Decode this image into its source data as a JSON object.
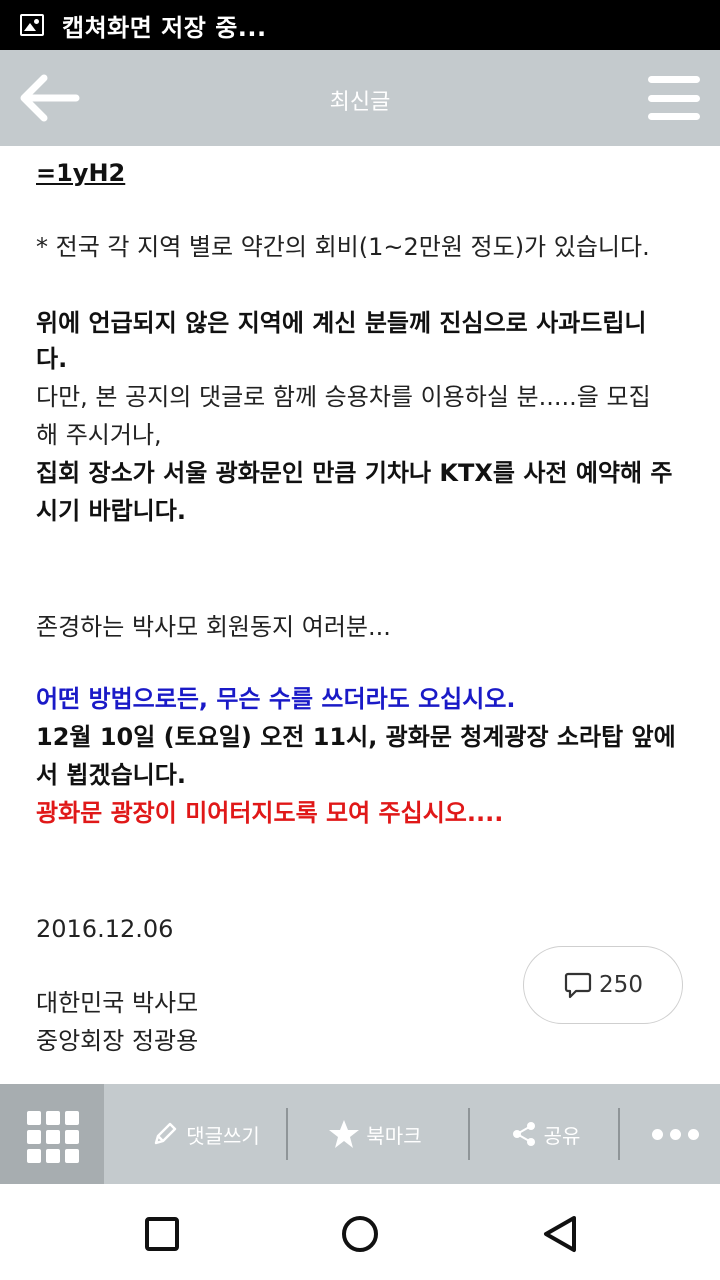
{
  "status_bar": {
    "text": "캡쳐화면 저장 중..."
  },
  "header": {
    "title": "최신글"
  },
  "post": {
    "code_line": "=1yH2",
    "fee_note": "* 전국 각 지역 별로 약간의 회비(1~2만원 정도)가 있습니다.",
    "apology_line1": "위에 언급되지 않은 지역에 계신 분들께 진심으로 사과드립니",
    "apology_line2": "다.",
    "carpool_line1": "다만, 본 공지의 댓글로 함께 승용차를 이용하실 분.....을 모집",
    "carpool_line2": "해 주시거나,",
    "train_line1": "집회 장소가 서울 광화문인 만큼 기차나 KTX를 사전 예약해 주",
    "train_line2": "시기 바랍니다.",
    "greeting": "존경하는 박사모 회원동지 여러분...",
    "call_blue": "어떤 방법으로든, 무슨 수를 쓰더라도 오십시오.",
    "time_line1": "12월 10일 (토요일) 오전 11시, 광화문 청계광장 소라탑 앞에",
    "time_line2": "서 뵙겠습니다.",
    "call_red": "광화문 광장이 미어터지도록 모여 주십시오....",
    "date": "2016.12.06",
    "org": "대한민국 박사모",
    "signer": "중앙회장 정광용"
  },
  "comments": {
    "count": "250"
  },
  "toolbar": {
    "write_comment": "댓글쓰기",
    "bookmark": "북마크",
    "share": "공유"
  },
  "colors": {
    "header_bg": "#c4cacd",
    "grid_bg": "#a7adb0",
    "blue_text": "#1a1ac7",
    "red_text": "#e01818"
  }
}
